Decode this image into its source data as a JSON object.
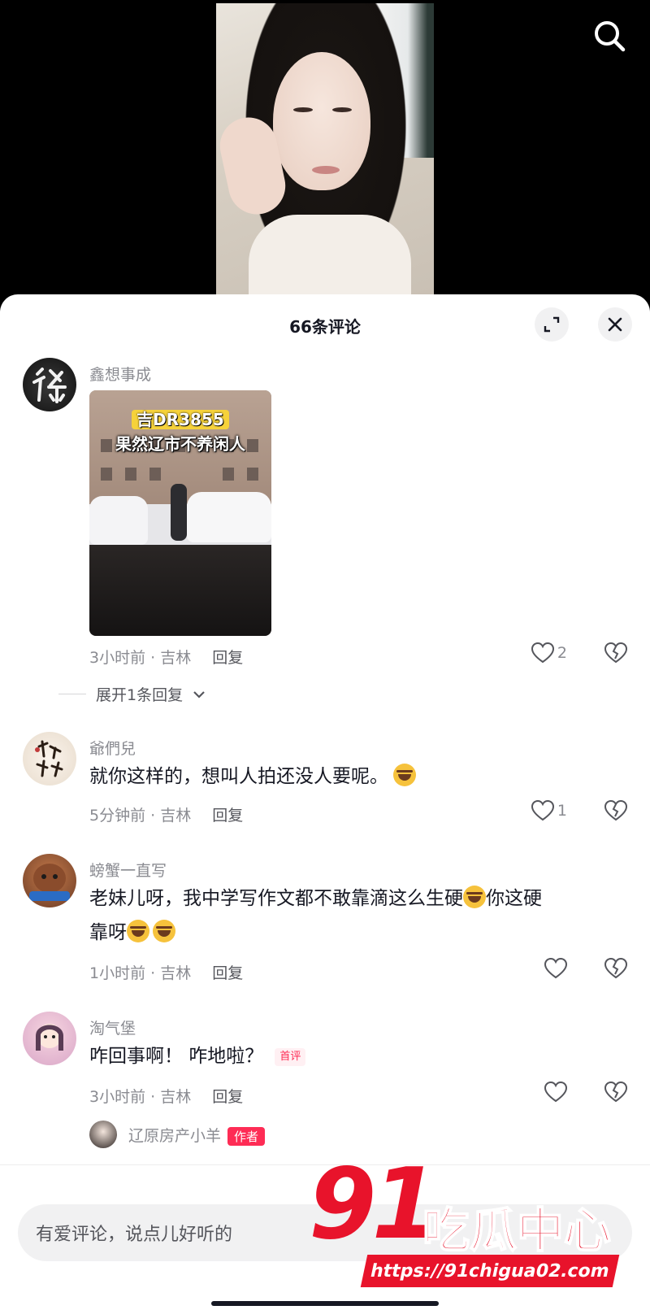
{
  "sheet": {
    "title": "66条评论"
  },
  "icons": {
    "search": "search-icon",
    "expand": "expand-icon",
    "close": "close-icon",
    "heart": "heart-icon",
    "broken_heart": "dislike-icon",
    "chevron": "chevron-down-icon",
    "emoji": "laugh-cry-emoji"
  },
  "colors": {
    "accent": "#fe2c55",
    "watermark": "#e8132b",
    "muted": "#8a8b91"
  },
  "comments": [
    {
      "name": "鑫想事成",
      "image_caption_1": "吉DR3855",
      "image_caption_2": "果然辽市不养闲人",
      "time": "3小时前 · 吉林",
      "reply": "回复",
      "likes": "2",
      "expand": "展开1条回复"
    },
    {
      "name": "爺們兒",
      "text": "就你这样的，想叫人拍还没人要呢。",
      "time": "5分钟前 · 吉林",
      "reply": "回复",
      "likes": "1"
    },
    {
      "name": "螃蟹一直写",
      "text_line1": "老妹儿呀，我中学写作文都不敢靠滴这么生硬",
      "text_line1_end": "你这硬",
      "text_line2": "靠呀",
      "time": "1小时前 · 吉林",
      "reply": "回复"
    },
    {
      "name": "淘气堡",
      "text": "咋回事啊！ 咋地啦？",
      "badge": "首评",
      "time": "3小时前 · 吉林",
      "reply": "回复"
    },
    {
      "name": "辽原房产小羊",
      "badge": "作者"
    }
  ],
  "input": {
    "placeholder": "有爱评论，说点儿好听的"
  },
  "watermark": {
    "number": "91",
    "text": "吃瓜中心",
    "url": "https://91chigua02.com"
  }
}
